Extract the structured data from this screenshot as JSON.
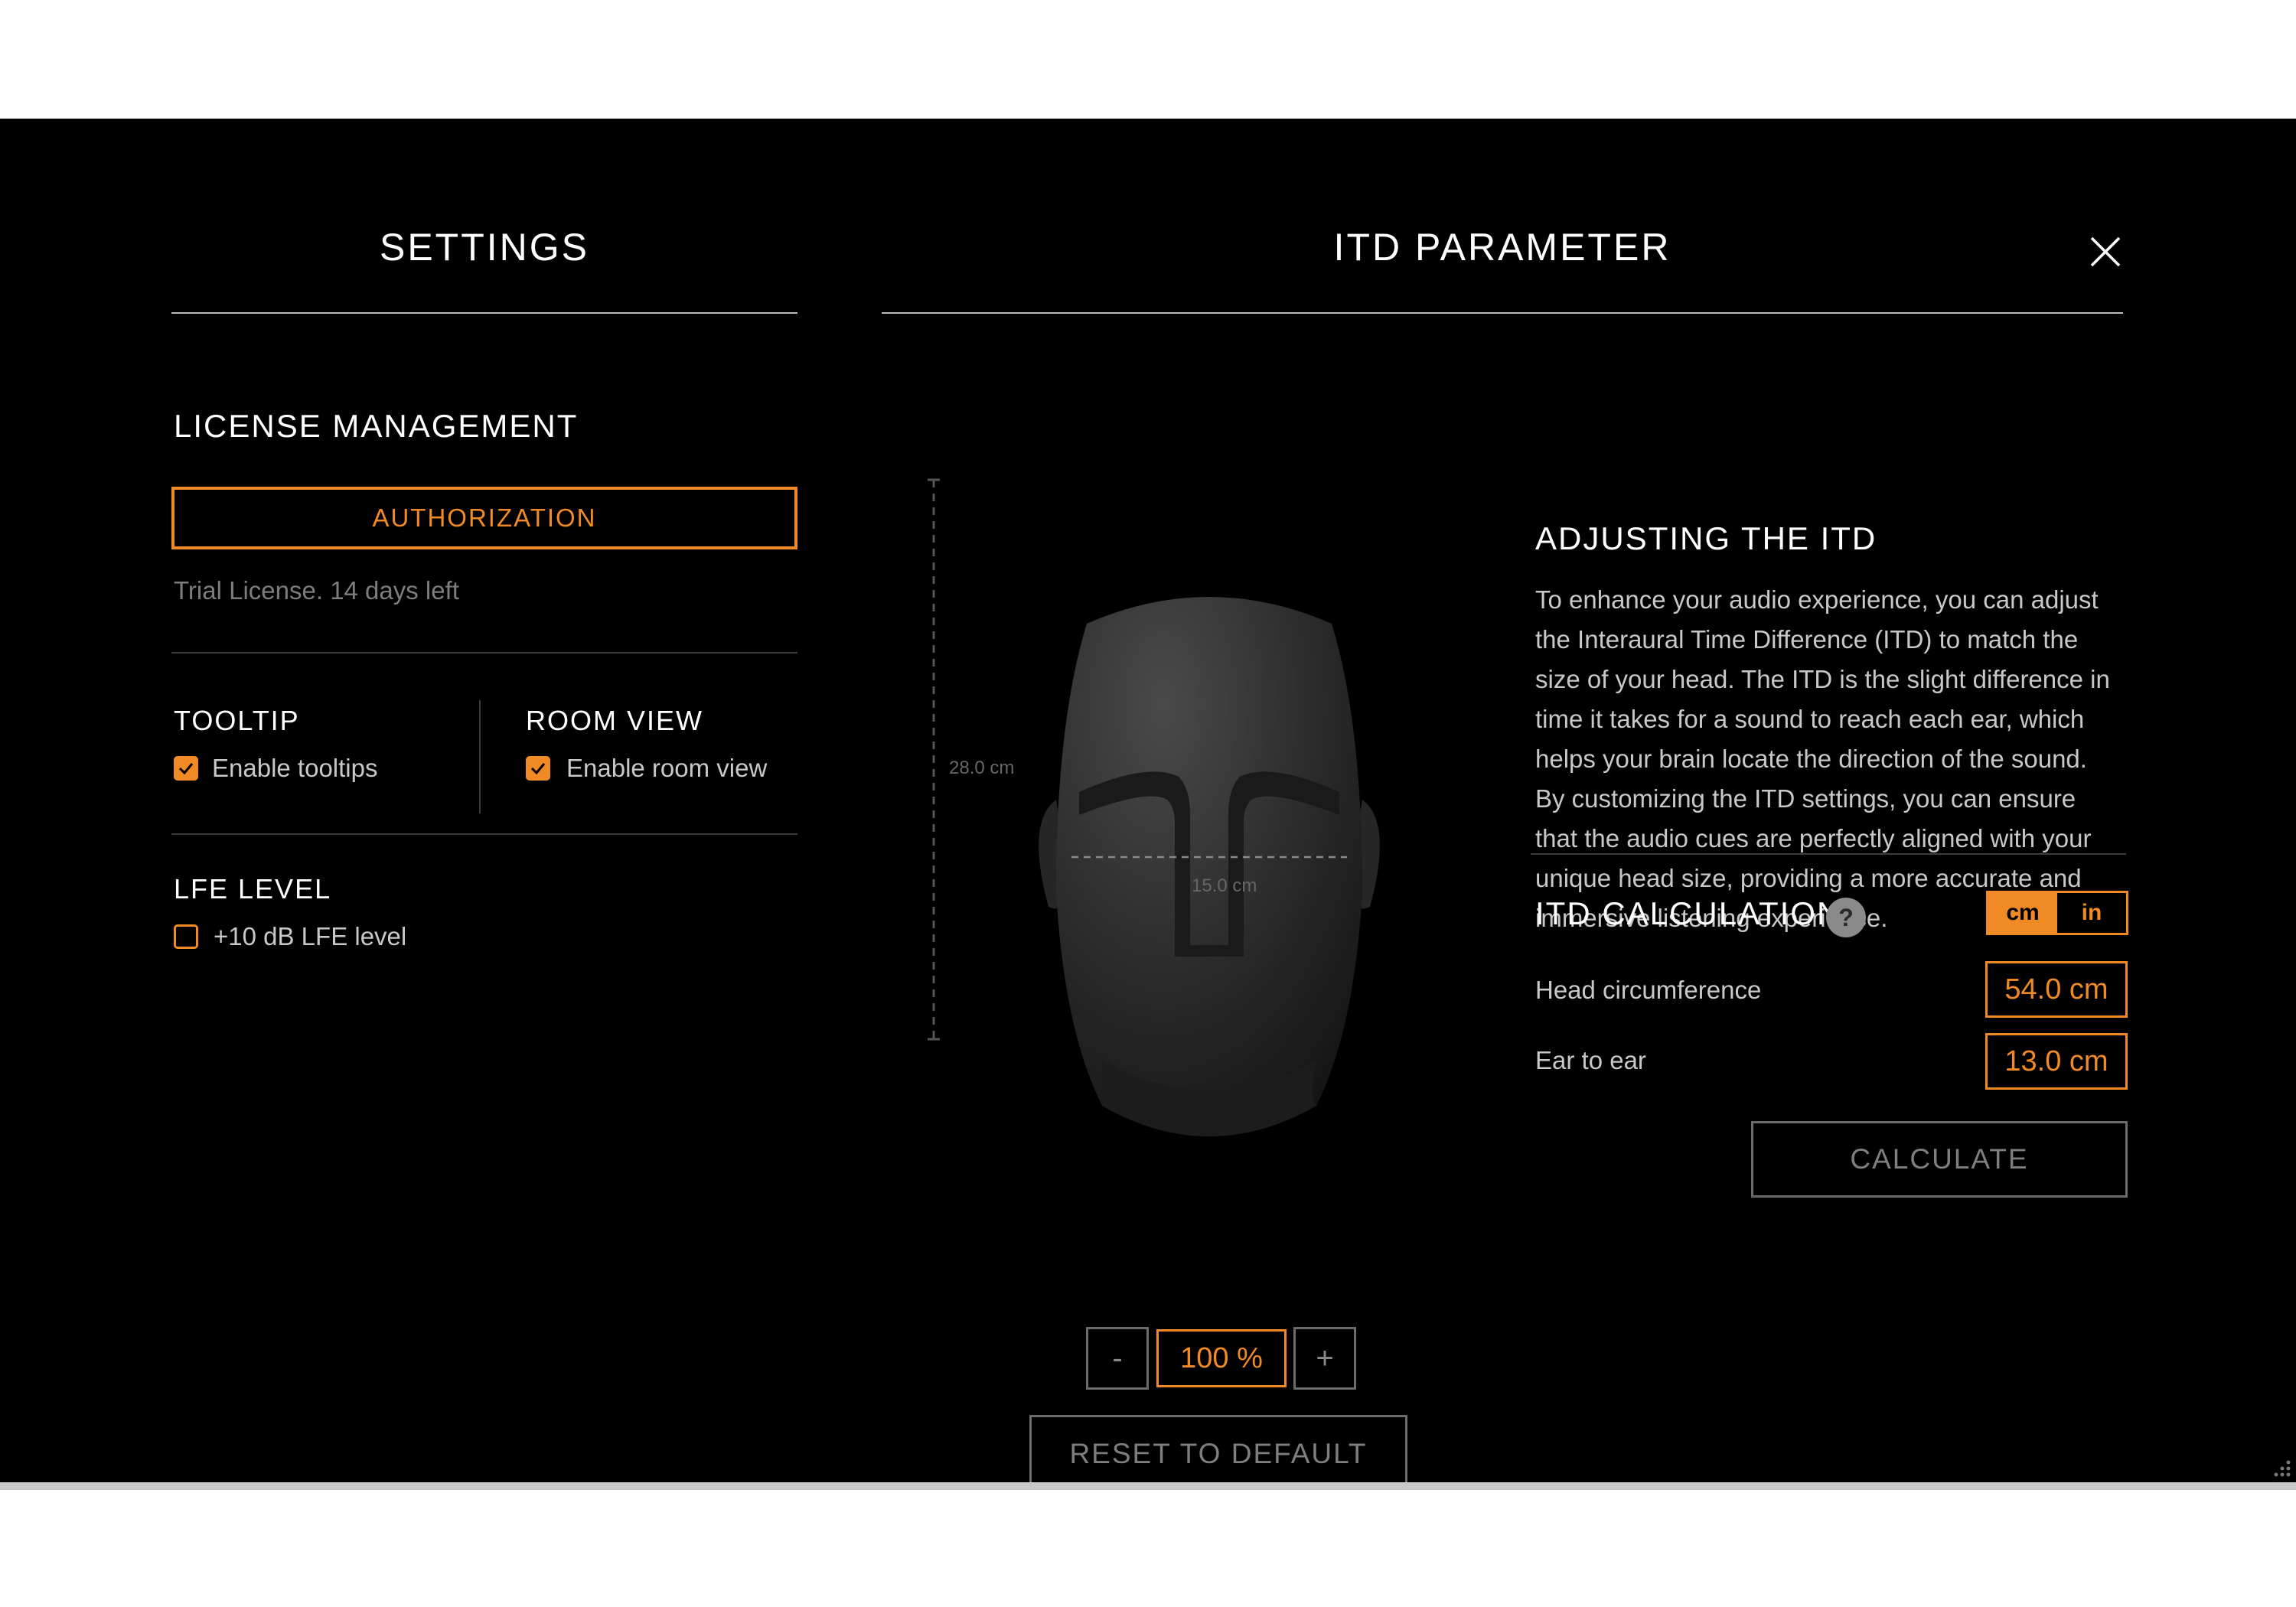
{
  "settings": {
    "title": "SETTINGS",
    "license": {
      "heading": "LICENSE MANAGEMENT",
      "auth_button": "AUTHORIZATION",
      "status": "Trial License. 14 days left"
    },
    "tooltip": {
      "heading": "TOOLTIP",
      "checkbox_label": "Enable tooltips",
      "checked": true
    },
    "room_view": {
      "heading": "ROOM VIEW",
      "checkbox_label": "Enable room view",
      "checked": true
    },
    "lfe": {
      "heading": "LFE LEVEL",
      "checkbox_label": "+10 dB LFE level",
      "checked": false
    }
  },
  "itd": {
    "title": "ITD PARAMETER",
    "close_icon": "close-icon",
    "head_view": {
      "height_label": "28.0 cm",
      "width_label": "15.0 cm",
      "zoom_minus": "-",
      "zoom_value": "100 %",
      "zoom_plus": "+",
      "reset_button": "RESET TO DEFAULT"
    },
    "adjusting": {
      "heading": "ADJUSTING THE ITD",
      "lines": [
        "To enhance your audio experience, you can adjust",
        "the Interaural Time Difference (ITD) to match the",
        "size of your head. The ITD is the slight difference in",
        "time it takes for a sound to reach each ear, which",
        "helps your brain locate the direction of the sound.",
        "By customizing the ITD settings, you can ensure",
        "that the audio cues are perfectly aligned with your",
        "unique head size, providing a more accurate and",
        "immersive listening experience."
      ]
    },
    "calculation": {
      "heading": "ITD CALCULATION",
      "help": "?",
      "unit_cm": "cm",
      "unit_in": "in",
      "active_unit": "cm",
      "head_circumference_label": "Head circumference",
      "head_circumference_value": "54.0 cm",
      "ear_to_ear_label": "Ear to ear",
      "ear_to_ear_value": "13.0 cm",
      "calculate_button": "CALCULATE"
    }
  },
  "colors": {
    "accent": "#f08a24",
    "background": "#000000",
    "text": "#ffffff",
    "muted": "#7d7d7d"
  }
}
